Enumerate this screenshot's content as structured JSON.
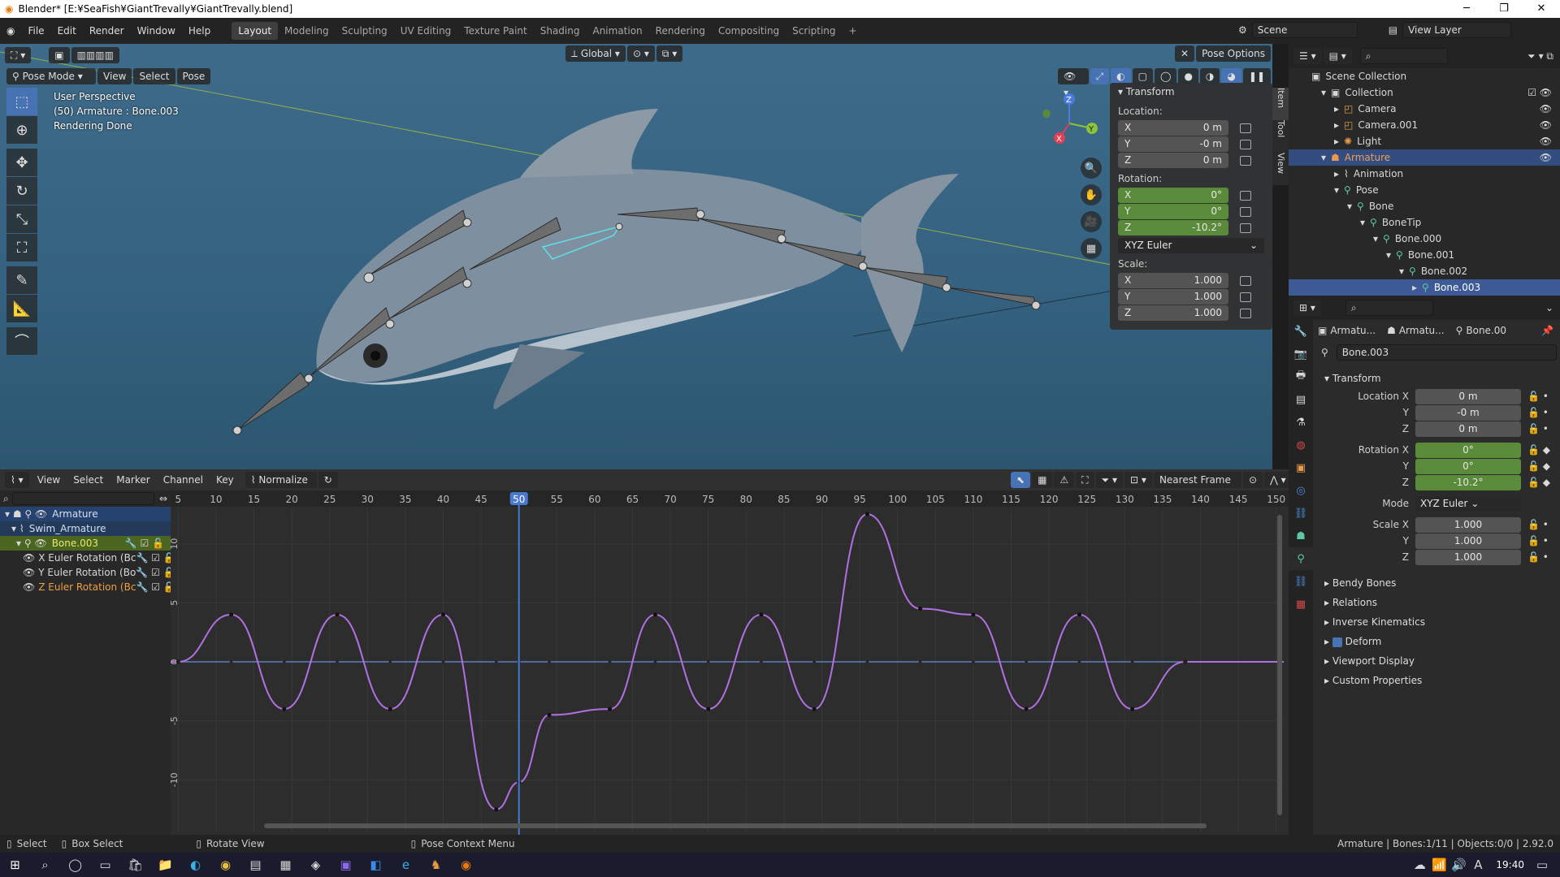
{
  "window": {
    "title": "Blender* [E:¥SeaFish¥GiantTrevally¥GiantTrevally.blend]"
  },
  "menu": [
    "File",
    "Edit",
    "Render",
    "Window",
    "Help"
  ],
  "workspaces": [
    "Layout",
    "Modeling",
    "Sculpting",
    "UV Editing",
    "Texture Paint",
    "Shading",
    "Animation",
    "Rendering",
    "Compositing",
    "Scripting"
  ],
  "scene": {
    "label": "Scene",
    "view_layer": "View Layer"
  },
  "viewport": {
    "mode": "Pose Mode",
    "menus": [
      "View",
      "Select",
      "Pose"
    ],
    "orientation": "Global",
    "pose_options": "Pose Options",
    "info": [
      "User Perspective",
      "(50) Armature : Bone.003",
      "Rendering Done"
    ],
    "side_tabs": [
      "Item",
      "Tool",
      "View"
    ]
  },
  "npanel": {
    "title": "Transform",
    "location_label": "Location:",
    "rotation_label": "Rotation:",
    "scale_label": "Scale:",
    "location": [
      {
        "axis": "X",
        "value": "0 m"
      },
      {
        "axis": "Y",
        "value": "-0 m"
      },
      {
        "axis": "Z",
        "value": "0 m"
      }
    ],
    "rotation": [
      {
        "axis": "X",
        "value": "0°"
      },
      {
        "axis": "Y",
        "value": "0°"
      },
      {
        "axis": "Z",
        "value": "-10.2°"
      }
    ],
    "rot_mode": "XYZ Euler",
    "scale": [
      {
        "axis": "X",
        "value": "1.000"
      },
      {
        "axis": "Y",
        "value": "1.000"
      },
      {
        "axis": "Z",
        "value": "1.000"
      }
    ]
  },
  "graph": {
    "menus": [
      "View",
      "Select",
      "Marker",
      "Channel",
      "Key"
    ],
    "normalize": "Normalize",
    "snap": "Nearest Frame",
    "current_frame": "50",
    "frame_ticks": [
      "5",
      "10",
      "15",
      "20",
      "25",
      "30",
      "35",
      "40",
      "45",
      "50",
      "55",
      "60",
      "65",
      "70",
      "75",
      "80",
      "85",
      "90",
      "95",
      "100",
      "105",
      "110",
      "115",
      "120",
      "125",
      "130",
      "135",
      "140",
      "145",
      "150"
    ],
    "value_ticks": [
      "10",
      "5",
      "0",
      "-5",
      "-10"
    ],
    "channels": [
      {
        "name": "Armature",
        "color": "#6ea0e6"
      },
      {
        "name": "Swim_Armature",
        "color": "#9ec8f0"
      },
      {
        "name": "Bone.003",
        "color": "#d8e056"
      },
      {
        "name": "X Euler Rotation (Bc",
        "color": "#e06060"
      },
      {
        "name": "Y Euler Rotation (Bo",
        "color": "#7ad060"
      },
      {
        "name": "Z Euler Rotation (Bc",
        "color": "#f0a040"
      }
    ],
    "curve_color": "#b070e0"
  },
  "chart_data": {
    "type": "line",
    "title": "",
    "xlabel": "",
    "ylabel": "",
    "xlim": [
      4,
      151
    ],
    "ylim": [
      -13,
      13
    ],
    "series": [
      {
        "name": "Z Euler Rotation (Bc",
        "x": [
          5,
          12,
          19,
          26,
          33,
          40,
          47,
          50,
          54,
          62,
          68,
          75,
          82,
          89,
          96,
          103,
          110,
          117,
          124,
          131,
          138
        ],
        "y": [
          0,
          4,
          -4,
          4,
          -4,
          4,
          -12.5,
          -10.2,
          -4.5,
          -4,
          4,
          -4,
          4,
          -4,
          12.5,
          4.5,
          4,
          -4,
          4,
          -4,
          0
        ]
      }
    ]
  },
  "outliner": {
    "rows": [
      {
        "name": "Scene Collection",
        "indent": 0
      },
      {
        "name": "Collection",
        "indent": 1
      },
      {
        "name": "Camera",
        "indent": 2
      },
      {
        "name": "Camera.001",
        "indent": 2
      },
      {
        "name": "Light",
        "indent": 2
      },
      {
        "name": "Armature",
        "indent": 1
      },
      {
        "name": "Animation",
        "indent": 2
      },
      {
        "name": "Pose",
        "indent": 2
      },
      {
        "name": "Bone",
        "indent": 3
      },
      {
        "name": "BoneTip",
        "indent": 4
      },
      {
        "name": "Bone.000",
        "indent": 5
      },
      {
        "name": "Bone.001",
        "indent": 6
      },
      {
        "name": "Bone.002",
        "indent": 7
      },
      {
        "name": "Bone.003",
        "indent": 8
      }
    ]
  },
  "properties": {
    "breadcrumb": [
      "Armatu...",
      "Armatu...",
      "Bone.00"
    ],
    "bone_name": "Bone.003",
    "section": "Transform",
    "location": [
      {
        "label": "Location X",
        "value": "0 m"
      },
      {
        "label": "Y",
        "value": "-0 m"
      },
      {
        "label": "Z",
        "value": "0 m"
      }
    ],
    "rotation": [
      {
        "label": "Rotation X",
        "value": "0°"
      },
      {
        "label": "Y",
        "value": "0°"
      },
      {
        "label": "Z",
        "value": "-10.2°"
      }
    ],
    "mode_label": "Mode",
    "mode_value": "XYZ Euler",
    "scale": [
      {
        "label": "Scale X",
        "value": "1.000"
      },
      {
        "label": "Y",
        "value": "1.000"
      },
      {
        "label": "Z",
        "value": "1.000"
      }
    ],
    "sections": [
      "Bendy Bones",
      "Relations",
      "Inverse Kinematics",
      "Deform",
      "Viewport Display",
      "Custom Properties"
    ]
  },
  "statusbar": {
    "select": "Select",
    "box_select": "Box Select",
    "rotate_view": "Rotate View",
    "context_menu": "Pose Context Menu",
    "stats": "Armature | Bones:1/11 | Objects:0/0 | 2.92.0"
  },
  "taskbar": {
    "time": "19:40"
  }
}
